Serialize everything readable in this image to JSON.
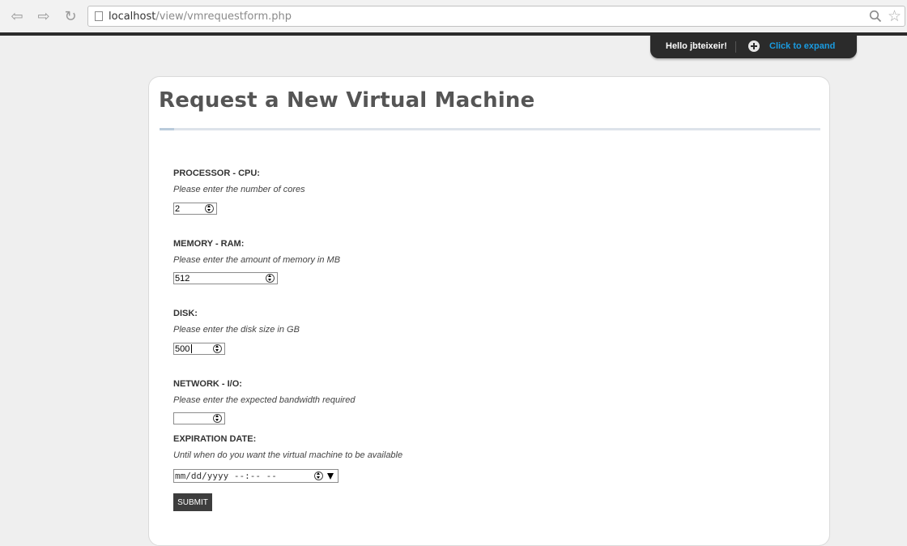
{
  "browser": {
    "url_host": "localhost",
    "url_path": "/view/vmrequestform.php"
  },
  "header_tab": {
    "greeting": "Hello jbteixeir!",
    "expand_label": "Click to expand"
  },
  "page": {
    "title": "Request a New Virtual Machine"
  },
  "form": {
    "cpu": {
      "label": "PROCESSOR - CPU:",
      "help": "Please enter the number of cores",
      "value": "2"
    },
    "memory": {
      "label": "MEMORY - RAM:",
      "help": "Please enter the amount of memory in MB",
      "value": "512"
    },
    "disk": {
      "label": "DISK:",
      "help": "Please enter the disk size in GB",
      "value": "500"
    },
    "network": {
      "label": "NETWORK - I/O:",
      "help": "Please enter the expected bandwidth required",
      "value": ""
    },
    "expiration": {
      "label": "EXPIRATION DATE:",
      "help": "Until when do you want the virtual machine to be available",
      "placeholder": "mm/dd/yyyy --:-- --"
    },
    "submit_label": "SUBMIT"
  }
}
